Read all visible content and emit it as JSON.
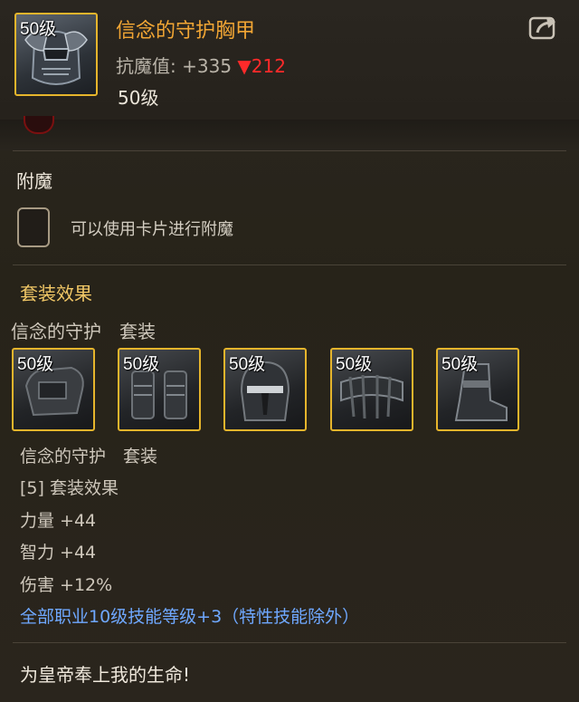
{
  "item": {
    "level_tag": "50级",
    "name": "信念的守护胸甲",
    "stat_label": "抗魔值:",
    "stat_value": "+335",
    "stat_diff": "▼212",
    "level_text": "50级",
    "icon": "chest-armor-icon"
  },
  "share_icon": "share-icon",
  "enchant": {
    "title": "附魔",
    "slot_text": "可以使用卡片进行附魔"
  },
  "set": {
    "title": "套装效果",
    "set_name": "信念的守护　套装",
    "pieces": [
      {
        "level_tag": "50级",
        "icon": "shoulder-armor-icon"
      },
      {
        "level_tag": "50级",
        "icon": "leg-armor-icon"
      },
      {
        "level_tag": "50级",
        "icon": "helmet-icon"
      },
      {
        "level_tag": "50级",
        "icon": "belt-icon"
      },
      {
        "level_tag": "50级",
        "icon": "boots-icon"
      }
    ],
    "lines": [
      "信念的守护　套装",
      "[5] 套装效果",
      "力量 +44",
      "智力 +44",
      "伤害 +12%"
    ],
    "skill_line": "全部职业10级技能等级+3（特性技能除外）"
  },
  "flavor_text": "为皇帝奉上我的生命!",
  "colors": {
    "item_name": "#f2a634",
    "stat_down": "#ff2a2a",
    "border_gold": "#e6b52c",
    "skill_blue": "#6fa8ff"
  }
}
